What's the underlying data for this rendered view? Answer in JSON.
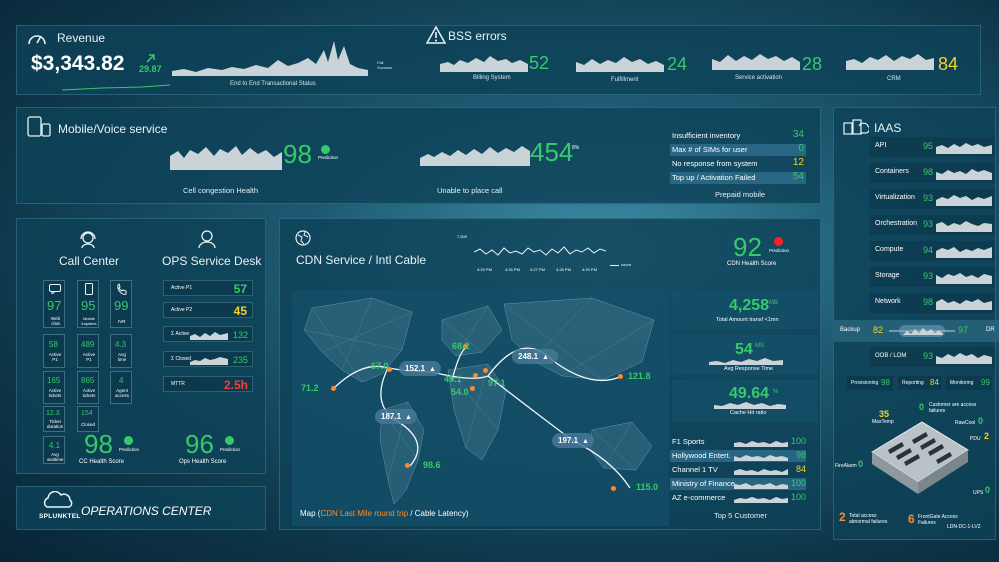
{
  "revenue": {
    "title": "Revenue",
    "amount": "$3,343.82",
    "delta": "29.87",
    "chart_label": "End to End Transactional Status",
    "legend_fail": "Fail",
    "legend_success": "Success"
  },
  "bss": {
    "title": "BSS errors",
    "items": [
      {
        "label": "Billing System",
        "value": "52"
      },
      {
        "label": "Fulfillment",
        "value": "24"
      },
      {
        "label": "Service activation",
        "value": "28"
      },
      {
        "label": "CRM",
        "value": "84"
      }
    ]
  },
  "mobile": {
    "title": "Mobile/Voice service",
    "cell_value": "98",
    "cell_prediction": "Prediction",
    "cell_label": "Cell congestion Health",
    "call_value": "454",
    "call_pct": "8%",
    "call_label": "Unable to place call"
  },
  "prepaid": {
    "title": "Prepaid mobile",
    "rows": [
      {
        "label": "Insufficient inventory",
        "value": "34",
        "color": "#36c96a"
      },
      {
        "label": "Max # of SIMs for user",
        "value": "0",
        "color": "#36c96a"
      },
      {
        "label": "No response from system",
        "value": "12",
        "color": "#f1d22e"
      },
      {
        "label": "Top up / Activation Failed",
        "value": "54",
        "color": "#36c96a"
      }
    ]
  },
  "iaas": {
    "title": "IAAS",
    "rows": [
      {
        "label": "API",
        "value": "95"
      },
      {
        "label": "Containers",
        "value": "98"
      },
      {
        "label": "Virtualization",
        "value": "93"
      },
      {
        "label": "Orchestration",
        "value": "93"
      },
      {
        "label": "Compute",
        "value": "94"
      },
      {
        "label": "Storage",
        "value": "93"
      },
      {
        "label": "Network",
        "value": "98"
      }
    ],
    "backup_label": "Backup",
    "backup_left": "82",
    "backup_right": "97",
    "dr_label": "DR",
    "oob_label": "OOB / LOM",
    "oob_value": "93",
    "provisioning_label": "Provisioning",
    "provisioning_value": "98",
    "reporting_label": "Reporting",
    "reporting_value": "84",
    "monitoring_label": "Monitoring",
    "monitoring_value": "99"
  },
  "datacenter": {
    "maxtemp_value": "35",
    "maxtemp_label": "MaxTemp",
    "customer_value": "0",
    "customer_label": "Customer are access failures",
    "rawcool_label": "RawCool",
    "rawcool_value": "0",
    "pdu_label": "PDU",
    "pdu_value": "2",
    "firealarm_label": "FireAlarm",
    "firealarm_value": "0",
    "ups_label": "UPS",
    "ups_value": "0",
    "total_value": "2",
    "total_label": "Total access abnormal failures",
    "frontgate_value": "6",
    "frontgate_label": "FrontGate Access Failures",
    "site_label": "LDN-DC-1-LV2"
  },
  "callcenter": {
    "title": "Call Center",
    "tiles": [
      {
        "value": "97",
        "label": "Web chat"
      },
      {
        "value": "95",
        "label": "Mobile inquiries"
      },
      {
        "value": "99",
        "label": "IVR"
      },
      {
        "value": "58",
        "label": "Active P1"
      },
      {
        "value": "489",
        "label": "Active P1"
      },
      {
        "value": "4.3",
        "label": "Avg time"
      },
      {
        "value": "165",
        "label": "Active tickets"
      },
      {
        "value": "865",
        "label": "Active tickets"
      },
      {
        "value": "4",
        "label": "Agent access"
      },
      {
        "value": "12.3",
        "label": "Ticket duration"
      },
      {
        "value": "154",
        "label": "Closed"
      },
      {
        "value": "4.1",
        "label": "Avg waittime"
      }
    ],
    "health_value": "98",
    "health_prediction": "Prediction",
    "health_label": "CC Health Score"
  },
  "ops": {
    "title": "OPS Service Desk",
    "rows": [
      {
        "label": "Active P1",
        "value": "57",
        "color": "#36c96a"
      },
      {
        "label": "Active P2",
        "value": "45",
        "color": "#f1d22e"
      },
      {
        "label": "Σ Active",
        "value": "132",
        "color": "#36c96a"
      },
      {
        "label": "Σ Closed",
        "value": "235",
        "color": "#36c96a"
      },
      {
        "label": "MTTR",
        "value": "2.5h",
        "color": "#ff3a3a"
      }
    ],
    "health_value": "96",
    "health_prediction": "Prediction",
    "health_label": "Ops Health Score"
  },
  "cdn": {
    "title": "CDN Service / Intl Cable",
    "y_tick": "7,500",
    "x_ticks": [
      "4:25 PM",
      "4:26 PM",
      "4:27 PM",
      "4:28 PM",
      "4:29 PM"
    ],
    "legend": "count",
    "health_value": "92",
    "health_prediction": "Prediction",
    "health_label": "CDN Health Score",
    "map_caption_prefix": "Map (",
    "map_caption_highlight": "CDN Last Mile round trip",
    "map_caption_suffix": " / Cable Latency)",
    "pills": [
      "152.1",
      "248.1",
      "187.1",
      "197.1"
    ],
    "points": [
      "71.2",
      "67.0",
      "68.2",
      "45.1",
      "54.0",
      "97.1",
      "121.8",
      "98.6",
      "115.0"
    ],
    "total_value": "4,258",
    "total_unit": "MB",
    "total_label": "Total Amount transf <1mn",
    "resp_value": "54",
    "resp_unit": "MS",
    "resp_label": "Avg Response Time",
    "cache_value": "49.64",
    "cache_unit": "%",
    "cache_label": "Cache Hit ratio"
  },
  "top5": {
    "title": "Top 5 Customer",
    "rows": [
      {
        "label": "F1 Sports",
        "value": "100",
        "color": "#36c96a"
      },
      {
        "label": "Hollywood Entert.",
        "value": "98",
        "color": "#36c96a"
      },
      {
        "label": "Channel 1 TV",
        "value": "84",
        "color": "#f1d22e"
      },
      {
        "label": "Ministry of Finance",
        "value": "100",
        "color": "#36c96a"
      },
      {
        "label": "AZ e-commerce",
        "value": "100",
        "color": "#36c96a"
      }
    ]
  },
  "brand": {
    "logo_text": "SPLUNKTEL",
    "center_title": "OPERATIONS CENTER"
  },
  "colors": {
    "green": "#36c96a",
    "yellow": "#f1d22e",
    "red": "#ff3a3a",
    "orange": "#ff8a2a"
  }
}
